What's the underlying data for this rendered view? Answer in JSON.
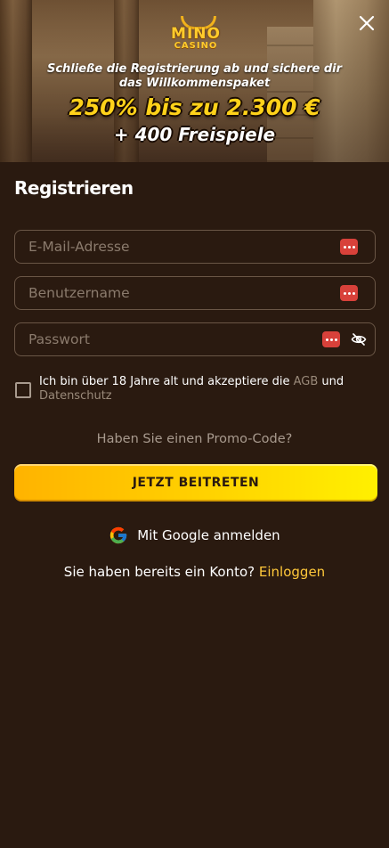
{
  "brand": {
    "logo_top": "MINO",
    "logo_bottom": "CASINO"
  },
  "hero": {
    "subtitle": "Schließe die Registrierung ab und sichere dir das Willkommenspaket",
    "amount": "250% bis zu 2.300 €",
    "spins": "+ 400 Freispiele"
  },
  "form": {
    "title": "Registrieren",
    "email_placeholder": "E-Mail-Adresse",
    "username_placeholder": "Benutzername",
    "password_placeholder": "Passwort",
    "terms_prefix": "Ich bin über 18 Jahre alt und akzeptiere die",
    "terms_link": "AGB",
    "terms_and": "und",
    "privacy_link": "Datenschutz",
    "promo_label": "Haben Sie einen Promo-Code?",
    "submit_label": "JETZT BEITRETEN",
    "google_label": "Mit Google anmelden",
    "login_prompt": "Sie haben bereits ein Konto?",
    "login_link": "Einloggen"
  },
  "icons": {
    "close": "close-icon",
    "password_manager": "password-manager-icon",
    "eye": "eye-off-icon",
    "google": "google-icon"
  },
  "colors": {
    "background": "#2a1a10",
    "accent": "#ffc83a",
    "button_start": "#ffb300",
    "button_end": "#fff000",
    "badge": "#d8413a"
  }
}
